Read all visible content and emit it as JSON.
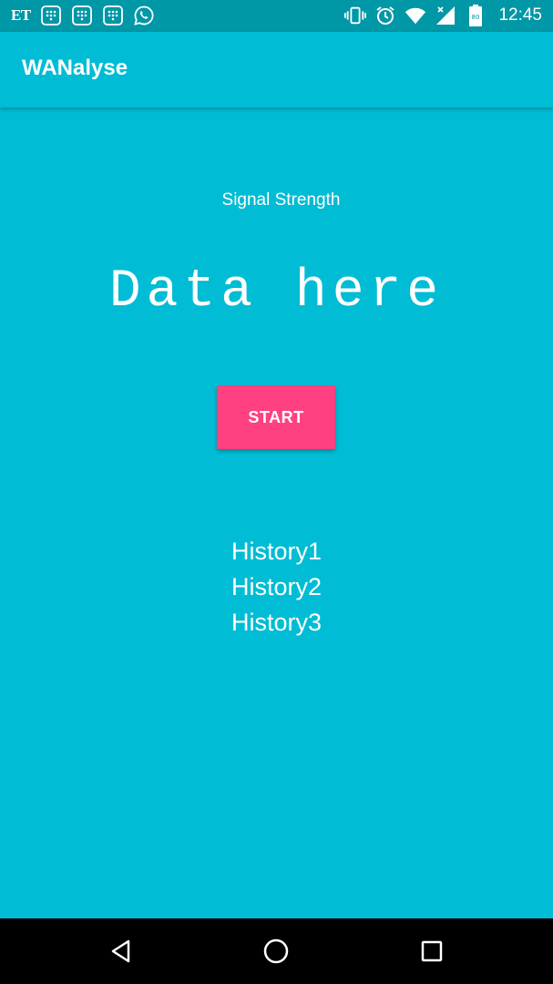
{
  "status_bar": {
    "carrier_label": "ET",
    "time": "12:45",
    "battery_level": "80",
    "icons": [
      "dialpad-icon",
      "dialpad-icon",
      "dialpad-icon",
      "whatsapp-icon",
      "vibrate-icon",
      "alarm-icon",
      "wifi-icon",
      "signal-icon",
      "battery-icon"
    ]
  },
  "app_bar": {
    "title": "WANalyse"
  },
  "main": {
    "signal_label": "Signal Strength",
    "data_text": "Data here",
    "start_label": "START",
    "history": [
      "History1",
      "History2",
      "History3"
    ]
  },
  "nav_bar": {
    "icons": [
      "back-icon",
      "home-icon",
      "recents-icon"
    ]
  },
  "colors": {
    "primary": "#00BCD4",
    "status_bar": "#0097A7",
    "accent": "#FF4081",
    "text": "#FFFFFF",
    "nav_bar": "#000000"
  }
}
